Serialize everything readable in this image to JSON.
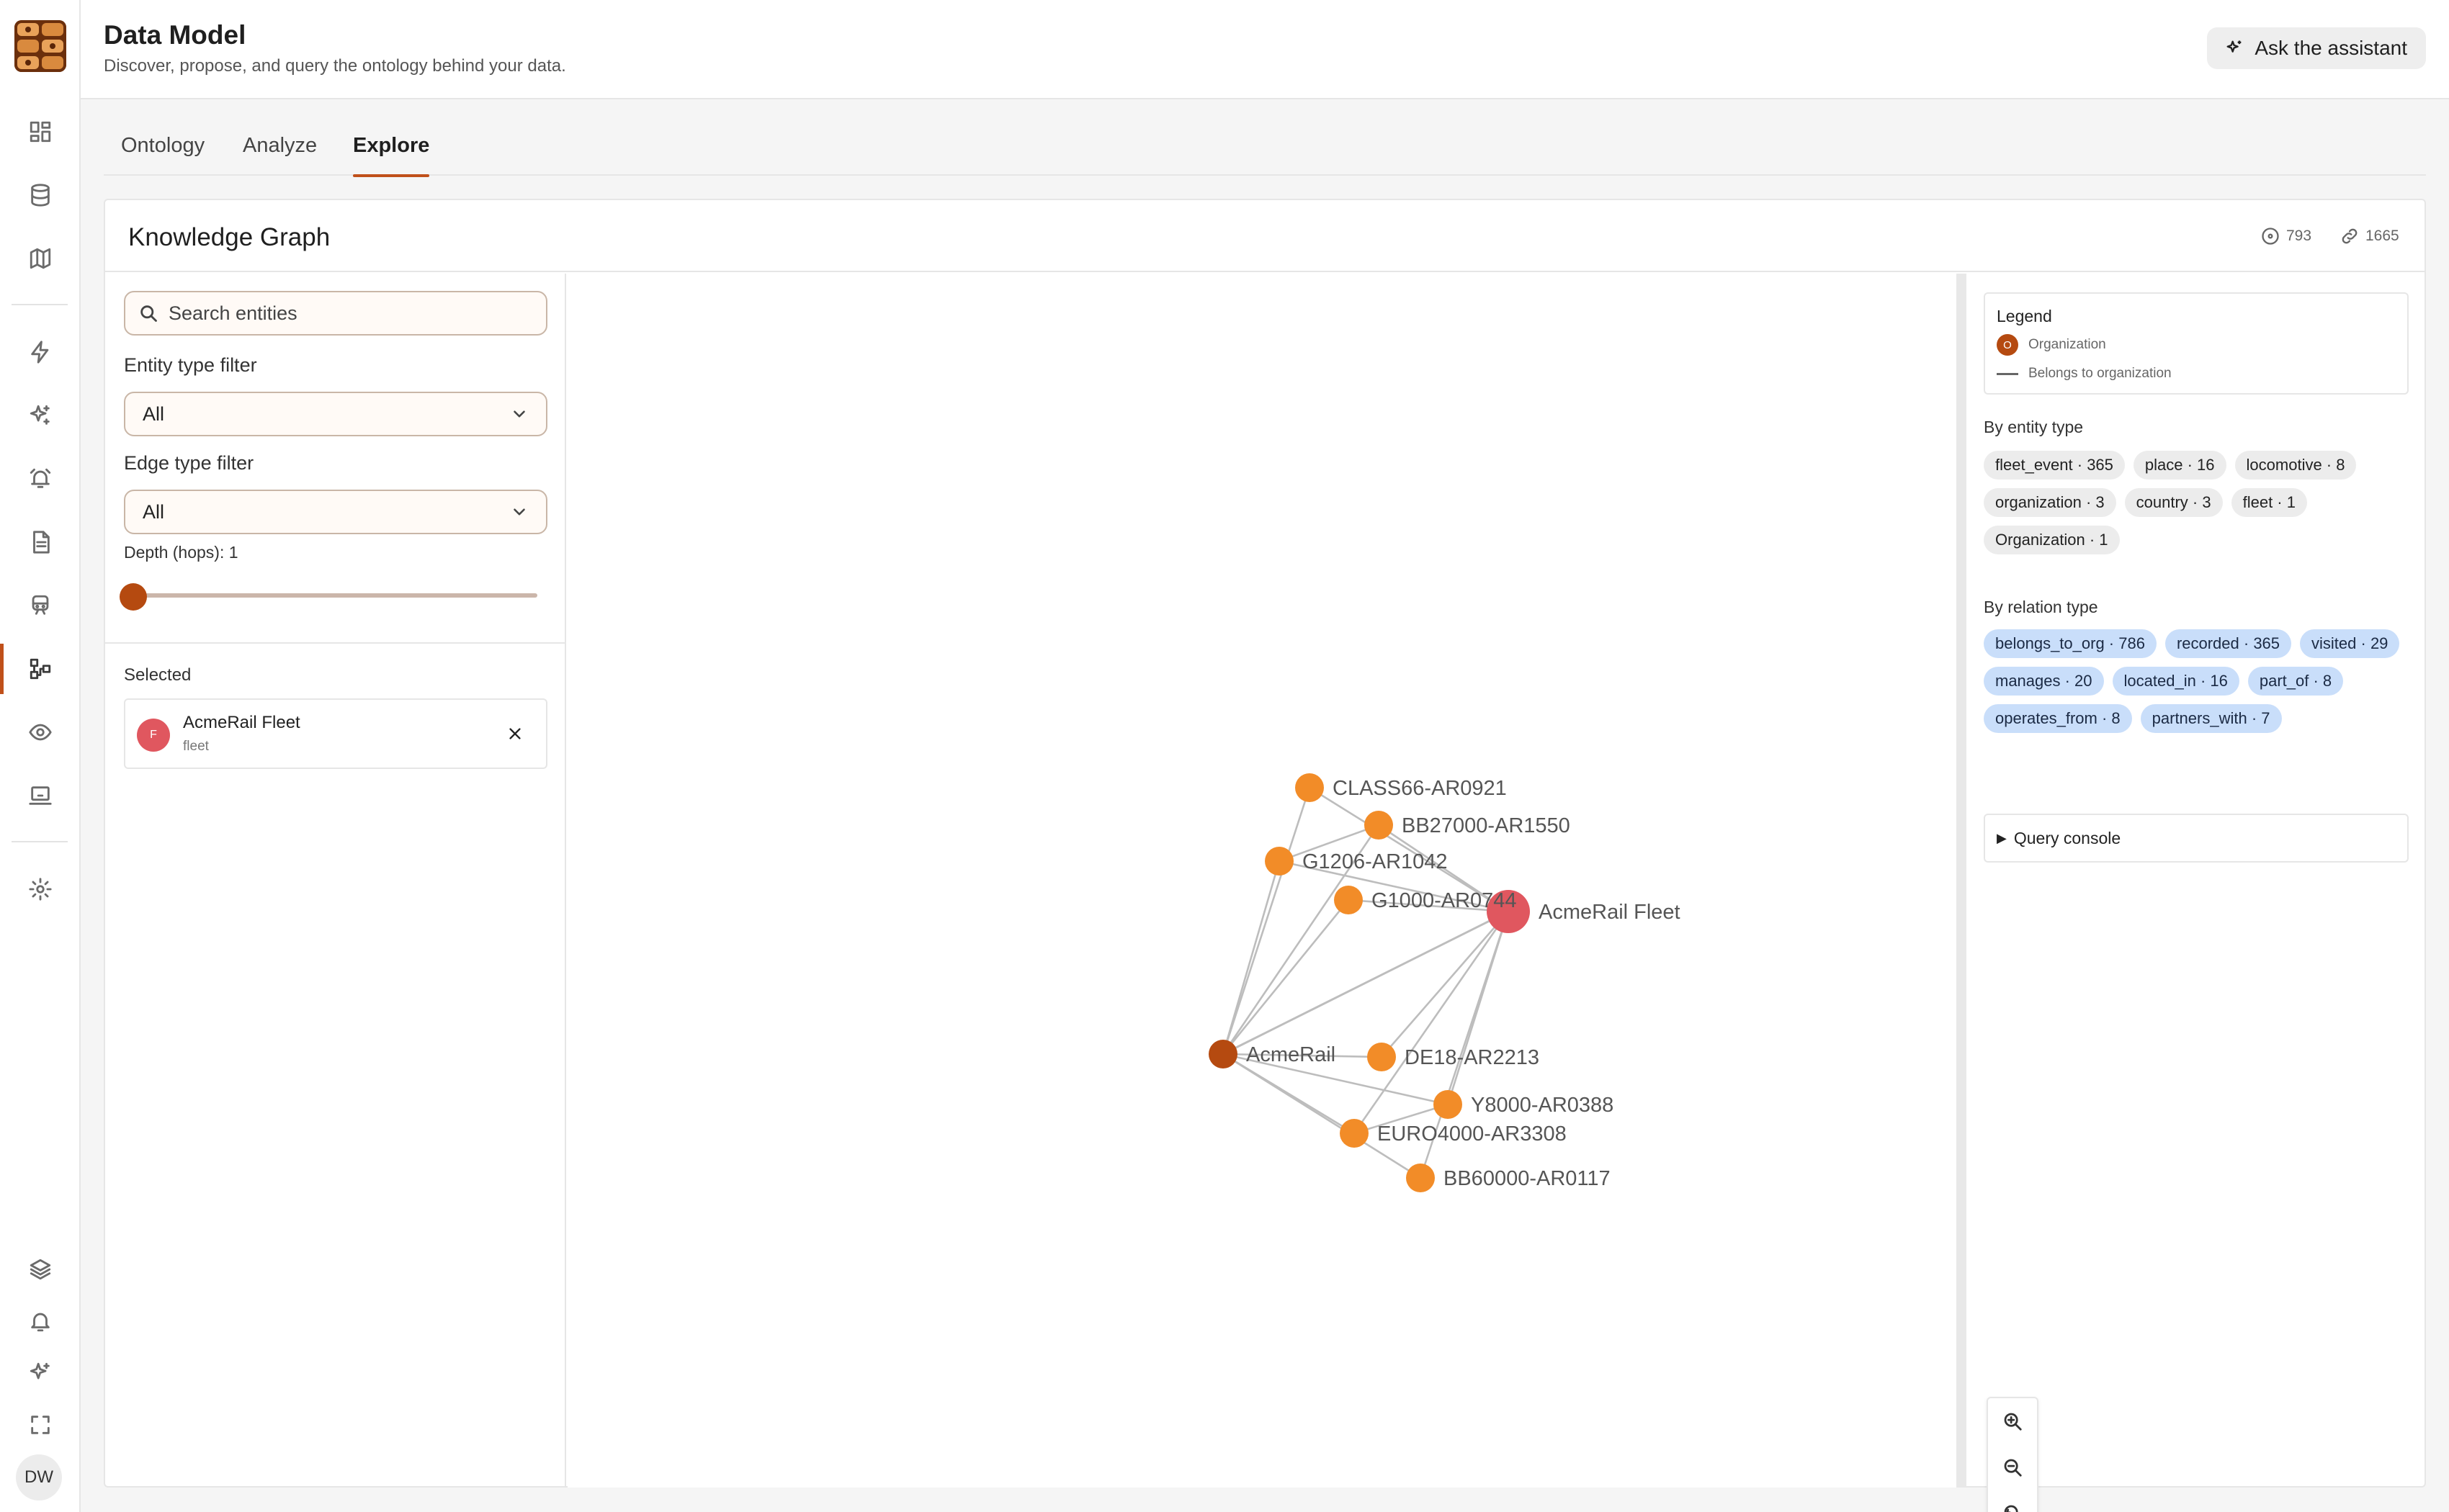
{
  "header": {
    "title": "Data Model",
    "subtitle": "Discover, propose, and query the ontology behind your data.",
    "assistant_label": "Ask the assistant"
  },
  "sidebar": {
    "items": [
      {
        "icon": "dashboard-icon"
      },
      {
        "icon": "database-icon"
      },
      {
        "icon": "map-icon"
      },
      {
        "icon": "lightning-icon"
      },
      {
        "icon": "sparkles-icon"
      },
      {
        "icon": "alarm-icon"
      },
      {
        "icon": "document-icon"
      },
      {
        "icon": "train-icon"
      },
      {
        "icon": "data-model-icon",
        "active": true
      },
      {
        "icon": "eye-icon"
      },
      {
        "icon": "monitor-icon"
      },
      {
        "icon": "settings-icon"
      }
    ],
    "bottom": [
      {
        "icon": "layers-icon"
      },
      {
        "icon": "bell-icon"
      },
      {
        "icon": "sparkles-icon"
      },
      {
        "icon": "fullscreen-icon"
      }
    ],
    "avatar_initials": "DW"
  },
  "tabs": [
    {
      "label": "Ontology",
      "active": false
    },
    {
      "label": "Analyze",
      "active": false
    },
    {
      "label": "Explore",
      "active": true
    }
  ],
  "card": {
    "title": "Knowledge Graph",
    "stats": {
      "entities": "793",
      "links": "1665"
    }
  },
  "filters": {
    "search_placeholder": "Search entities",
    "entity_type_label": "Entity type filter",
    "entity_type_value": "All",
    "edge_type_label": "Edge type filter",
    "edge_type_value": "All",
    "depth_label": "Depth (hops): 1",
    "depth_value": 1
  },
  "selected": {
    "label": "Selected",
    "name": "AcmeRail Fleet",
    "type": "fleet",
    "initial": "F"
  },
  "graph": {
    "colors": {
      "organization": "#b54a10",
      "locomotive": "#f28c28",
      "fleet": "#e0575f",
      "edge": "#bdbdbd"
    },
    "nodes": [
      {
        "id": "acmerail",
        "label": "AcmeRail",
        "kind": "organization"
      },
      {
        "id": "fleet",
        "label": "AcmeRail Fleet",
        "kind": "fleet"
      },
      {
        "id": "class66",
        "label": "CLASS66-AR0921",
        "kind": "locomotive"
      },
      {
        "id": "bb27000",
        "label": "BB27000-AR1550",
        "kind": "locomotive"
      },
      {
        "id": "g1206",
        "label": "G1206-AR1042",
        "kind": "locomotive"
      },
      {
        "id": "g1000",
        "label": "G1000-AR0744",
        "kind": "locomotive"
      },
      {
        "id": "de18",
        "label": "DE18-AR2213",
        "kind": "locomotive"
      },
      {
        "id": "y8000",
        "label": "Y8000-AR0388",
        "kind": "locomotive"
      },
      {
        "id": "euro4000",
        "label": "EURO4000-AR3308",
        "kind": "locomotive"
      },
      {
        "id": "bb60000",
        "label": "BB60000-AR0117",
        "kind": "locomotive"
      }
    ]
  },
  "legend": {
    "title": "Legend",
    "node_initial": "O",
    "node_label": "Organization",
    "edge_label": "Belongs to organization"
  },
  "entity_types": {
    "title": "By entity type",
    "chips": [
      "fleet_event · 365",
      "place · 16",
      "locomotive · 8",
      "organization · 3",
      "country · 3",
      "fleet · 1",
      "Organization · 1"
    ]
  },
  "relation_types": {
    "title": "By relation type",
    "chips": [
      "belongs_to_org · 786",
      "recorded · 365",
      "visited · 29",
      "manages · 20",
      "located_in · 16",
      "part_of · 8",
      "operates_from · 8",
      "partners_with · 7"
    ]
  },
  "query_console_label": "Query console"
}
